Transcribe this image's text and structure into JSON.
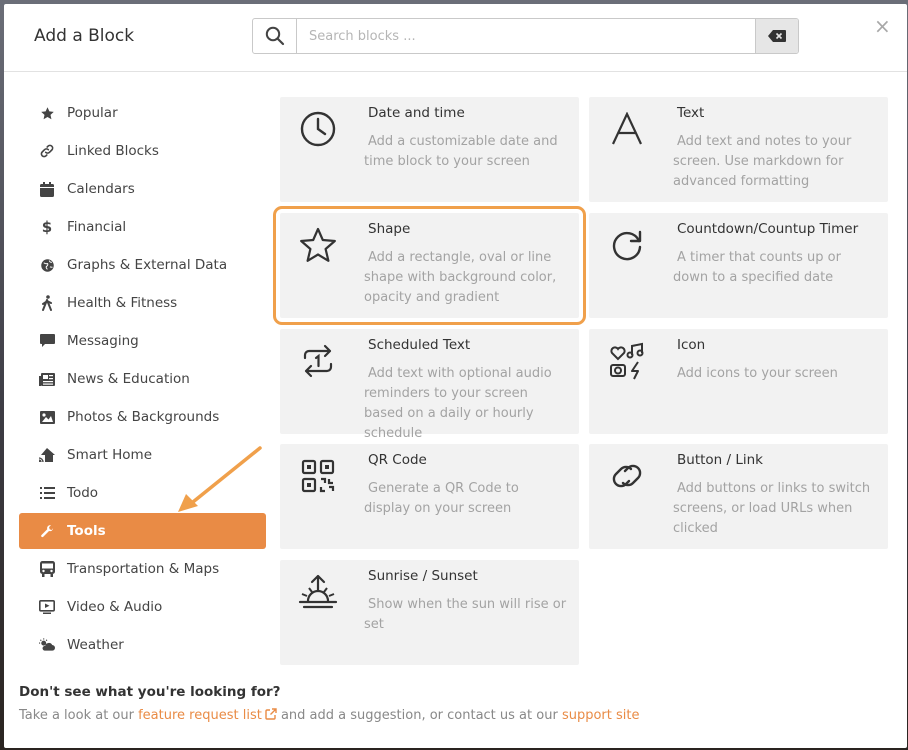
{
  "header": {
    "title": "Add a Block",
    "search_placeholder": "Search blocks ...",
    "close_glyph": "×"
  },
  "sidebar": {
    "items": [
      {
        "label": "Popular",
        "icon": "star-icon"
      },
      {
        "label": "Linked Blocks",
        "icon": "link-icon"
      },
      {
        "label": "Calendars",
        "icon": "calendar-icon"
      },
      {
        "label": "Financial",
        "icon": "dollar-icon"
      },
      {
        "label": "Graphs & External Data",
        "icon": "globe-icon"
      },
      {
        "label": "Health & Fitness",
        "icon": "walking-icon"
      },
      {
        "label": "Messaging",
        "icon": "message-icon"
      },
      {
        "label": "News & Education",
        "icon": "newspaper-icon"
      },
      {
        "label": "Photos & Backgrounds",
        "icon": "image-icon"
      },
      {
        "label": "Smart Home",
        "icon": "smart-home-icon"
      },
      {
        "label": "Todo",
        "icon": "list-icon"
      },
      {
        "label": "Tools",
        "icon": "wrench-icon",
        "active": true
      },
      {
        "label": "Transportation & Maps",
        "icon": "bus-icon"
      },
      {
        "label": "Video & Audio",
        "icon": "tv-icon"
      },
      {
        "label": "Weather",
        "icon": "weather-icon"
      }
    ]
  },
  "blocks": [
    {
      "title": "Date and time",
      "desc": "Add a customizable date and time block to your screen",
      "icon": "clock-icon"
    },
    {
      "title": "Text",
      "desc": "Add text and notes to your screen. Use markdown for advanced formatting",
      "icon": "text-a-icon"
    },
    {
      "title": "Shape",
      "desc": "Add a rectangle, oval or line shape with background color, opacity and gradient",
      "icon": "star-outline-icon"
    },
    {
      "title": "Countdown/Countup Timer",
      "desc": "A timer that counts up or down to a specified date",
      "icon": "redo-icon"
    },
    {
      "title": "Scheduled Text",
      "desc": "Add text with optional audio reminders to your screen based on a daily or hourly schedule",
      "icon": "repeat-one-icon"
    },
    {
      "title": "Icon",
      "desc": "Add icons to your screen",
      "icon": "icons-icon"
    },
    {
      "title": "QR Code",
      "desc": "Generate a QR Code to display on your screen",
      "icon": "qr-code-icon"
    },
    {
      "title": "Button / Link",
      "desc": "Add buttons or links to switch screens, or load URLs when clicked",
      "icon": "link-chain-icon"
    },
    {
      "title": "Sunrise / Sunset",
      "desc": "Show when the sun will rise or set",
      "icon": "sunrise-icon"
    }
  ],
  "footer": {
    "title": "Don't see what you're looking for?",
    "text_before": "Take a look at our ",
    "link1": "feature request list",
    "text_middle": " and add a suggestion, or contact us at our ",
    "link2": "support site"
  },
  "colors": {
    "accent": "#e98b45",
    "highlight": "#f0a04b"
  }
}
